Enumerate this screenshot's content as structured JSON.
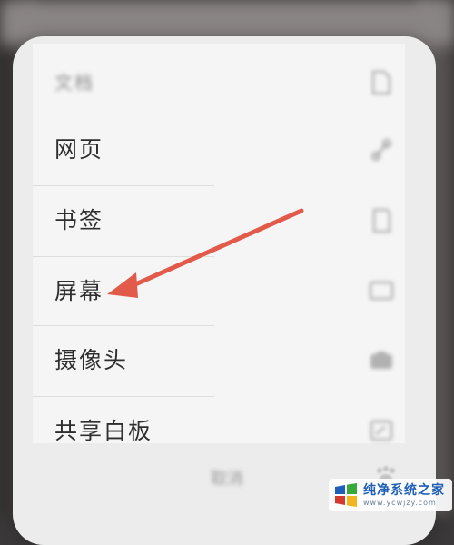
{
  "menu": {
    "items": [
      {
        "label": "文档",
        "icon": "document-icon",
        "blurred": true
      },
      {
        "label": "网页",
        "icon": "link-icon"
      },
      {
        "label": "书签",
        "icon": "bookmark-icon"
      },
      {
        "label": "屏幕",
        "icon": "screen-icon"
      },
      {
        "label": "摄像头",
        "icon": "camera-icon"
      },
      {
        "label": "共享白板",
        "icon": "whiteboard-icon"
      }
    ],
    "cancel_label": "取消"
  },
  "annotation": {
    "arrow_color": "#e15a4a",
    "points_to": "屏幕"
  },
  "watermark": {
    "title": "纯净系统之家",
    "url": "www.ycwjzy.com",
    "colors": {
      "blue": "#1f5fb6",
      "green": "#36a93a",
      "red": "#d63a2f",
      "yellow": "#f2b51d"
    }
  }
}
